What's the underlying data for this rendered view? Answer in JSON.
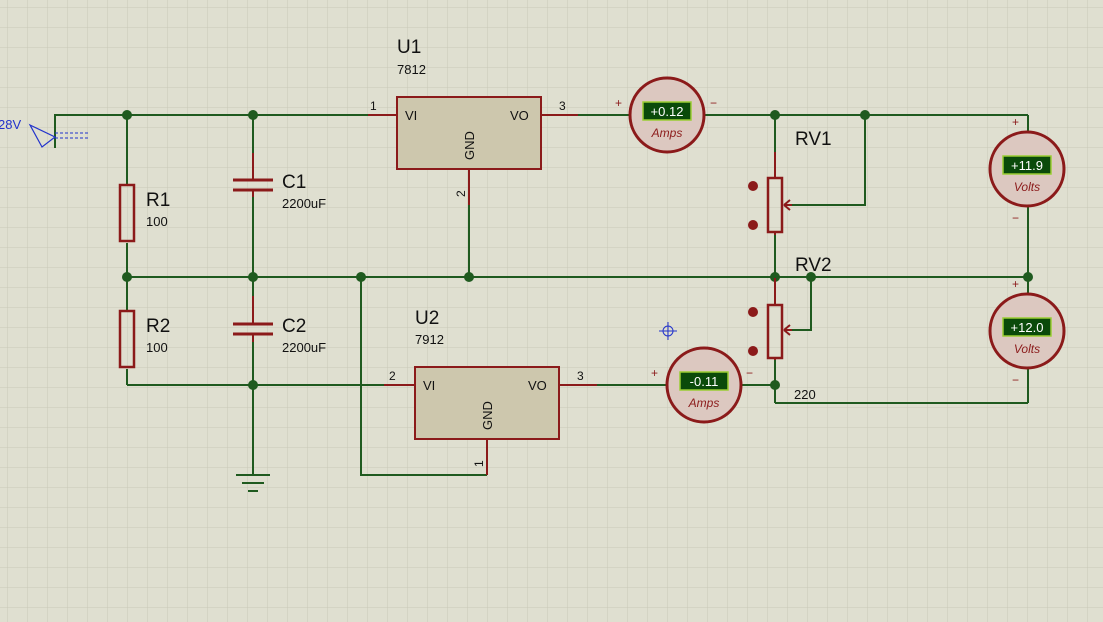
{
  "source": {
    "label": "28V"
  },
  "regulators": [
    {
      "ref": "U1",
      "value": "7812",
      "pin_in": "1",
      "pin_out": "3",
      "pin_gnd": "2",
      "in_label": "VI",
      "out_label": "VO",
      "gnd_label": "GND"
    },
    {
      "ref": "U2",
      "value": "7912",
      "pin_in": "2",
      "pin_out": "3",
      "pin_gnd": "1",
      "in_label": "VI",
      "out_label": "VO",
      "gnd_label": "GND"
    }
  ],
  "resistors": [
    {
      "ref": "R1",
      "value": "100"
    },
    {
      "ref": "R2",
      "value": "100"
    }
  ],
  "capacitors": [
    {
      "ref": "C1",
      "value": "2200uF"
    },
    {
      "ref": "C2",
      "value": "2200uF"
    }
  ],
  "potentiometers": [
    {
      "ref": "RV1",
      "value": ""
    },
    {
      "ref": "RV2",
      "value": "220"
    }
  ],
  "meters": [
    {
      "id": "ammeter-1",
      "reading": "+0.12",
      "unit": "Amps",
      "plus": "+",
      "minus": "−"
    },
    {
      "id": "ammeter-2",
      "reading": "-0.11",
      "unit": "Amps",
      "plus": "+",
      "minus": "−"
    },
    {
      "id": "voltmeter-1",
      "reading": "+11.9",
      "unit": "Volts",
      "plus": "+",
      "minus": "−"
    },
    {
      "id": "voltmeter-2",
      "reading": "+12.0",
      "unit": "Volts",
      "plus": "+",
      "minus": "−"
    }
  ],
  "colors": {
    "background": "#dfdfd0",
    "grid": "#c9c9b8",
    "wire": "#1f5a1f",
    "component": "#8b1a1a",
    "chip_fill": "#cdc7ad",
    "display_bg": "#0a4a0a",
    "display_border": "#9acd32"
  }
}
